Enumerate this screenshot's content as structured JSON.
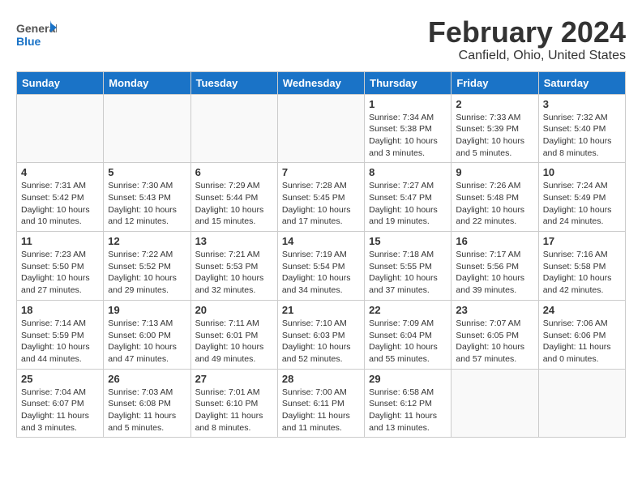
{
  "header": {
    "logo_general": "General",
    "logo_blue": "Blue",
    "title": "February 2024",
    "subtitle": "Canfield, Ohio, United States"
  },
  "weekdays": [
    "Sunday",
    "Monday",
    "Tuesday",
    "Wednesday",
    "Thursday",
    "Friday",
    "Saturday"
  ],
  "weeks": [
    [
      {
        "day": "",
        "info": ""
      },
      {
        "day": "",
        "info": ""
      },
      {
        "day": "",
        "info": ""
      },
      {
        "day": "",
        "info": ""
      },
      {
        "day": "1",
        "info": "Sunrise: 7:34 AM\nSunset: 5:38 PM\nDaylight: 10 hours\nand 3 minutes."
      },
      {
        "day": "2",
        "info": "Sunrise: 7:33 AM\nSunset: 5:39 PM\nDaylight: 10 hours\nand 5 minutes."
      },
      {
        "day": "3",
        "info": "Sunrise: 7:32 AM\nSunset: 5:40 PM\nDaylight: 10 hours\nand 8 minutes."
      }
    ],
    [
      {
        "day": "4",
        "info": "Sunrise: 7:31 AM\nSunset: 5:42 PM\nDaylight: 10 hours\nand 10 minutes."
      },
      {
        "day": "5",
        "info": "Sunrise: 7:30 AM\nSunset: 5:43 PM\nDaylight: 10 hours\nand 12 minutes."
      },
      {
        "day": "6",
        "info": "Sunrise: 7:29 AM\nSunset: 5:44 PM\nDaylight: 10 hours\nand 15 minutes."
      },
      {
        "day": "7",
        "info": "Sunrise: 7:28 AM\nSunset: 5:45 PM\nDaylight: 10 hours\nand 17 minutes."
      },
      {
        "day": "8",
        "info": "Sunrise: 7:27 AM\nSunset: 5:47 PM\nDaylight: 10 hours\nand 19 minutes."
      },
      {
        "day": "9",
        "info": "Sunrise: 7:26 AM\nSunset: 5:48 PM\nDaylight: 10 hours\nand 22 minutes."
      },
      {
        "day": "10",
        "info": "Sunrise: 7:24 AM\nSunset: 5:49 PM\nDaylight: 10 hours\nand 24 minutes."
      }
    ],
    [
      {
        "day": "11",
        "info": "Sunrise: 7:23 AM\nSunset: 5:50 PM\nDaylight: 10 hours\nand 27 minutes."
      },
      {
        "day": "12",
        "info": "Sunrise: 7:22 AM\nSunset: 5:52 PM\nDaylight: 10 hours\nand 29 minutes."
      },
      {
        "day": "13",
        "info": "Sunrise: 7:21 AM\nSunset: 5:53 PM\nDaylight: 10 hours\nand 32 minutes."
      },
      {
        "day": "14",
        "info": "Sunrise: 7:19 AM\nSunset: 5:54 PM\nDaylight: 10 hours\nand 34 minutes."
      },
      {
        "day": "15",
        "info": "Sunrise: 7:18 AM\nSunset: 5:55 PM\nDaylight: 10 hours\nand 37 minutes."
      },
      {
        "day": "16",
        "info": "Sunrise: 7:17 AM\nSunset: 5:56 PM\nDaylight: 10 hours\nand 39 minutes."
      },
      {
        "day": "17",
        "info": "Sunrise: 7:16 AM\nSunset: 5:58 PM\nDaylight: 10 hours\nand 42 minutes."
      }
    ],
    [
      {
        "day": "18",
        "info": "Sunrise: 7:14 AM\nSunset: 5:59 PM\nDaylight: 10 hours\nand 44 minutes."
      },
      {
        "day": "19",
        "info": "Sunrise: 7:13 AM\nSunset: 6:00 PM\nDaylight: 10 hours\nand 47 minutes."
      },
      {
        "day": "20",
        "info": "Sunrise: 7:11 AM\nSunset: 6:01 PM\nDaylight: 10 hours\nand 49 minutes."
      },
      {
        "day": "21",
        "info": "Sunrise: 7:10 AM\nSunset: 6:03 PM\nDaylight: 10 hours\nand 52 minutes."
      },
      {
        "day": "22",
        "info": "Sunrise: 7:09 AM\nSunset: 6:04 PM\nDaylight: 10 hours\nand 55 minutes."
      },
      {
        "day": "23",
        "info": "Sunrise: 7:07 AM\nSunset: 6:05 PM\nDaylight: 10 hours\nand 57 minutes."
      },
      {
        "day": "24",
        "info": "Sunrise: 7:06 AM\nSunset: 6:06 PM\nDaylight: 11 hours\nand 0 minutes."
      }
    ],
    [
      {
        "day": "25",
        "info": "Sunrise: 7:04 AM\nSunset: 6:07 PM\nDaylight: 11 hours\nand 3 minutes."
      },
      {
        "day": "26",
        "info": "Sunrise: 7:03 AM\nSunset: 6:08 PM\nDaylight: 11 hours\nand 5 minutes."
      },
      {
        "day": "27",
        "info": "Sunrise: 7:01 AM\nSunset: 6:10 PM\nDaylight: 11 hours\nand 8 minutes."
      },
      {
        "day": "28",
        "info": "Sunrise: 7:00 AM\nSunset: 6:11 PM\nDaylight: 11 hours\nand 11 minutes."
      },
      {
        "day": "29",
        "info": "Sunrise: 6:58 AM\nSunset: 6:12 PM\nDaylight: 11 hours\nand 13 minutes."
      },
      {
        "day": "",
        "info": ""
      },
      {
        "day": "",
        "info": ""
      }
    ]
  ]
}
